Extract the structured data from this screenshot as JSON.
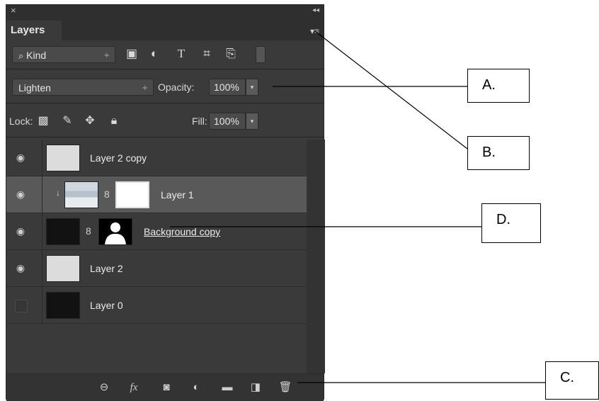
{
  "panel": {
    "close_glyph": "×",
    "collapse_glyph": "◂◂",
    "tab_label": "Layers",
    "menu_glyph": "▾≡"
  },
  "filter": {
    "kind_label": "Kind",
    "kind_arrow": "÷",
    "icons": [
      "image-filter-icon",
      "adjustment-filter-icon",
      "type-filter-icon",
      "shape-filter-icon",
      "smart-object-filter-icon",
      "filter-toggle-icon"
    ]
  },
  "blend": {
    "mode": "Lighten",
    "mode_arrow": "÷",
    "opacity_label": "Opacity:",
    "opacity_value": "100%"
  },
  "lock": {
    "label": "Lock:",
    "fill_label": "Fill:",
    "fill_value": "100%"
  },
  "layers": [
    {
      "name": "Layer 2 copy",
      "visible": true,
      "thumb": "plain"
    },
    {
      "name": "Layer 1",
      "visible": true,
      "thumb": "pic",
      "has_mask": true,
      "clipped": true,
      "selected": true
    },
    {
      "name": "Background copy",
      "visible": true,
      "thumb": "dark",
      "has_mask": true
    },
    {
      "name": "Layer 2",
      "visible": true,
      "thumb": "plain"
    },
    {
      "name": "Layer 0",
      "visible": false,
      "thumb": "dark"
    }
  ],
  "footer_icons": [
    "link-layers-icon",
    "fx-icon",
    "add-mask-icon",
    "adjustment-layer-icon",
    "group-folder-icon",
    "new-layer-icon",
    "trash-icon"
  ],
  "fx_text": "fx",
  "callouts": {
    "a": "A.",
    "b": "B.",
    "c": "C.",
    "d": "D."
  }
}
